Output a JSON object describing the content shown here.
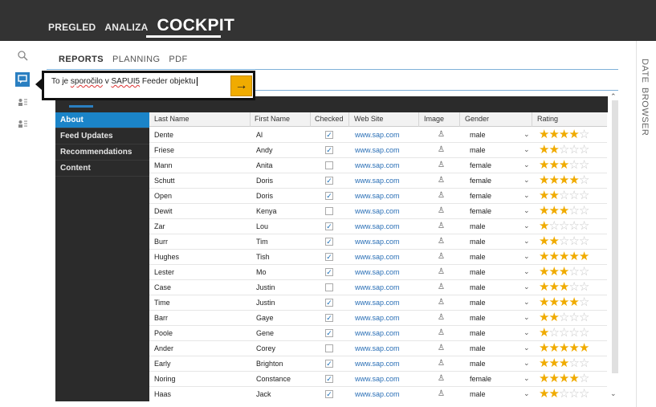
{
  "top_nav": [
    {
      "label": "PREGLED",
      "active": false
    },
    {
      "label": "ANALIZA",
      "active": false
    },
    {
      "label": "COCKPIT",
      "active": true
    }
  ],
  "sub_nav": [
    {
      "label": "REPORTS",
      "active": true
    },
    {
      "label": "PLANNING",
      "active": false
    },
    {
      "label": "PDF",
      "active": false
    }
  ],
  "left_icons": [
    "search-icon",
    "feeder-chat-icon",
    "contacts-list-icon",
    "contacts-list-icon"
  ],
  "right_vertical": [
    "DATE",
    "BROWSER"
  ],
  "feeder": {
    "text_before": "To je ",
    "text_misspelled": "sporočilo",
    "text_mid": " v ",
    "text_brand": "SAPUI5",
    "text_after": " Feeder objektu",
    "button_icon": "arrow-right-icon"
  },
  "side_menu": [
    {
      "label": "About",
      "active": true
    },
    {
      "label": "Feed Updates",
      "active": false
    },
    {
      "label": "Recommendations",
      "active": false
    },
    {
      "label": "Content",
      "active": false
    }
  ],
  "columns": [
    "Last Name",
    "First Name",
    "Checked",
    "Web Site",
    "Image",
    "Gender",
    "Rating"
  ],
  "rows": [
    {
      "last": "Dente",
      "first": "Al",
      "checked": true,
      "web": "www.sap.com",
      "gender": "male",
      "rating": 4
    },
    {
      "last": "Friese",
      "first": "Andy",
      "checked": true,
      "web": "www.sap.com",
      "gender": "male",
      "rating": 2
    },
    {
      "last": "Mann",
      "first": "Anita",
      "checked": false,
      "web": "www.sap.com",
      "gender": "female",
      "rating": 3
    },
    {
      "last": "Schutt",
      "first": "Doris",
      "checked": true,
      "web": "www.sap.com",
      "gender": "female",
      "rating": 4
    },
    {
      "last": "Open",
      "first": "Doris",
      "checked": true,
      "web": "www.sap.com",
      "gender": "female",
      "rating": 2
    },
    {
      "last": "Dewit",
      "first": "Kenya",
      "checked": false,
      "web": "www.sap.com",
      "gender": "female",
      "rating": 3
    },
    {
      "last": "Zar",
      "first": "Lou",
      "checked": true,
      "web": "www.sap.com",
      "gender": "male",
      "rating": 1
    },
    {
      "last": "Burr",
      "first": "Tim",
      "checked": true,
      "web": "www.sap.com",
      "gender": "male",
      "rating": 2
    },
    {
      "last": "Hughes",
      "first": "Tish",
      "checked": true,
      "web": "www.sap.com",
      "gender": "male",
      "rating": 5
    },
    {
      "last": "Lester",
      "first": "Mo",
      "checked": true,
      "web": "www.sap.com",
      "gender": "male",
      "rating": 3
    },
    {
      "last": "Case",
      "first": "Justin",
      "checked": false,
      "web": "www.sap.com",
      "gender": "male",
      "rating": 3
    },
    {
      "last": "Time",
      "first": "Justin",
      "checked": true,
      "web": "www.sap.com",
      "gender": "male",
      "rating": 4
    },
    {
      "last": "Barr",
      "first": "Gaye",
      "checked": true,
      "web": "www.sap.com",
      "gender": "male",
      "rating": 2
    },
    {
      "last": "Poole",
      "first": "Gene",
      "checked": true,
      "web": "www.sap.com",
      "gender": "male",
      "rating": 1
    },
    {
      "last": "Ander",
      "first": "Corey",
      "checked": false,
      "web": "www.sap.com",
      "gender": "male",
      "rating": 5
    },
    {
      "last": "Early",
      "first": "Brighton",
      "checked": true,
      "web": "www.sap.com",
      "gender": "male",
      "rating": 3
    },
    {
      "last": "Noring",
      "first": "Constance",
      "checked": true,
      "web": "www.sap.com",
      "gender": "female",
      "rating": 4
    },
    {
      "last": "Haas",
      "first": "Jack",
      "checked": true,
      "web": "www.sap.com",
      "gender": "male",
      "rating": 2
    }
  ],
  "colors": {
    "accent": "#1b84c8",
    "star": "#f0ab00",
    "topbar": "#333333",
    "menu": "#2b2b2b"
  }
}
